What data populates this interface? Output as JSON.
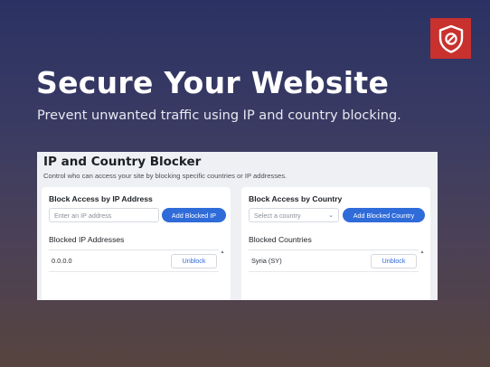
{
  "brand": {
    "logo_icon": "shield-icon",
    "color": "#c8312e"
  },
  "hero": {
    "title": "Secure Your Website",
    "subtitle": "Prevent unwanted traffic using IP and country blocking."
  },
  "app": {
    "title": "IP and Country Blocker",
    "description": "Control who can access your site by blocking specific countries or IP addresses.",
    "ip_card": {
      "heading": "Block Access by IP Address",
      "input_placeholder": "Enter an IP address",
      "add_button": "Add Blocked IP",
      "list_label": "Blocked  IP Addresses",
      "items": [
        {
          "value": "0.0.0.0",
          "action": "Unblock"
        }
      ]
    },
    "country_card": {
      "heading": "Block Access by Country",
      "select_placeholder": "Select a country",
      "add_button": "Add Blocked Country",
      "list_label": "Blocked Countries",
      "items": [
        {
          "value": "Syria (SY)",
          "action": "Unblock"
        }
      ]
    },
    "accent_color": "#2f6bd9"
  }
}
